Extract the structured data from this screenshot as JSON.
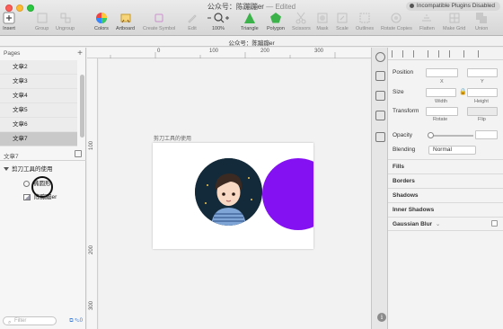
{
  "window": {
    "document_title": "公众号：陈蹦蹦er",
    "edited_suffix": "— Edited",
    "plugins_badge": "Incompatible Plugins Disabled"
  },
  "toolbar": {
    "items": [
      {
        "label": "Insert",
        "icon": "plus-icon"
      },
      {
        "label": "Group",
        "icon": "group-icon"
      },
      {
        "label": "Ungroup",
        "icon": "ungroup-icon"
      },
      {
        "label": "Colors",
        "icon": "color-wheel-icon"
      },
      {
        "label": "Artboard",
        "icon": "artboard-icon"
      },
      {
        "label": "Create Symbol",
        "icon": "symbol-icon"
      },
      {
        "label": "Edit",
        "icon": "edit-icon"
      },
      {
        "label": "100%",
        "icon": "zoom-icon"
      },
      {
        "label": "Triangle",
        "icon": "triangle-icon"
      },
      {
        "label": "Polygon",
        "icon": "polygon-icon"
      },
      {
        "label": "Scissors",
        "icon": "scissors-icon"
      },
      {
        "label": "Mask",
        "icon": "mask-icon"
      },
      {
        "label": "Scale",
        "icon": "scale-icon"
      },
      {
        "label": "Outlines",
        "icon": "outlines-icon"
      },
      {
        "label": "Rotate Copies",
        "icon": "rotate-copies-icon"
      },
      {
        "label": "Flatten",
        "icon": "flatten-icon"
      },
      {
        "label": "Make Grid",
        "icon": "make-grid-icon"
      },
      {
        "label": "Union",
        "icon": "union-icon"
      }
    ]
  },
  "subbar": {
    "tab_title": "公众号：陈蹦蹦er"
  },
  "sidebar": {
    "pages_header": "Pages",
    "pages": [
      "文章2",
      "文章3",
      "文章4",
      "文章5",
      "文章6",
      "文章7"
    ],
    "selected_page": "文章7",
    "current_page_label": "文章7",
    "layers": [
      {
        "name": "剪刀工具的使用",
        "type": "artboard"
      },
      {
        "name": "椭圆形",
        "type": "oval"
      },
      {
        "name": "陈蹦蹦er",
        "type": "image"
      }
    ],
    "filter_placeholder": "Filter",
    "filter_extra": "0"
  },
  "ruler": {
    "h_ticks": [
      "0",
      "100",
      "200",
      "300"
    ],
    "v_ticks": [
      "100",
      "200",
      "300"
    ]
  },
  "canvas": {
    "artboard_name": "剪刀工具的使用",
    "shape_color": "#8411f2",
    "avatar_bg": "#132a3a"
  },
  "inspector": {
    "position_label": "Position",
    "x_label": "X",
    "y_label": "Y",
    "size_label": "Size",
    "width_label": "Width",
    "height_label": "Height",
    "transform_label": "Transform",
    "rotate_label": "Rotate",
    "flip_label": "Flip",
    "opacity_label": "Opacity",
    "blending_label": "Blending",
    "blending_value": "Normal",
    "sections": [
      "Fills",
      "Borders",
      "Shadows",
      "Inner Shadows",
      "Gaussian Blur"
    ]
  }
}
